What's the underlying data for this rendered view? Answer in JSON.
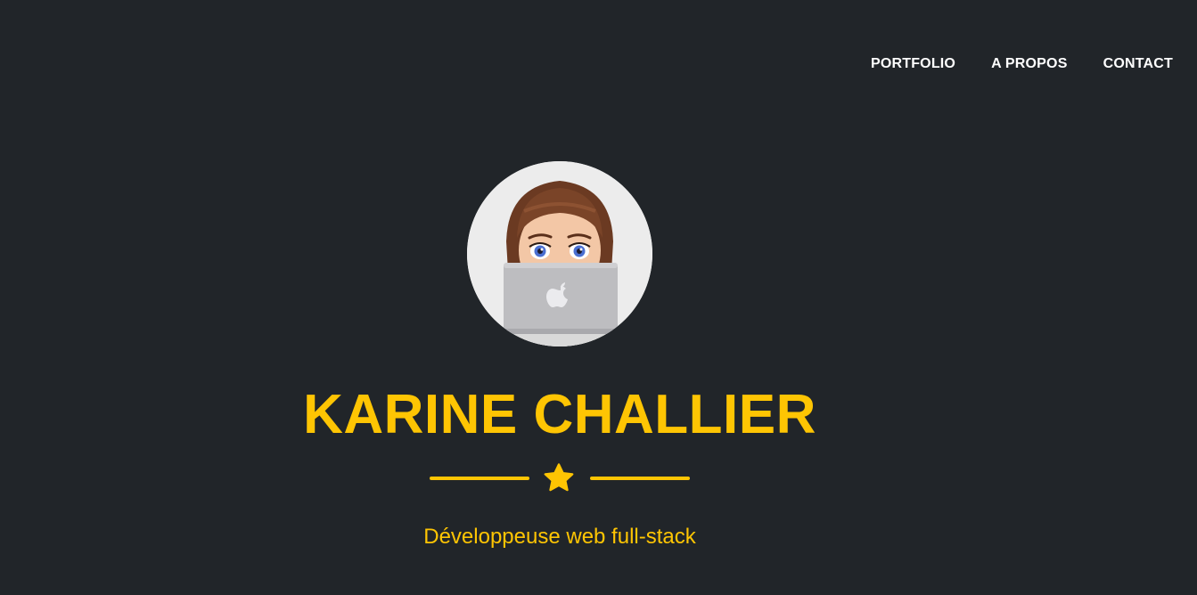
{
  "nav": {
    "items": [
      {
        "label": "PORTFOLIO"
      },
      {
        "label": "A PROPOS"
      },
      {
        "label": "CONTACT"
      }
    ]
  },
  "hero": {
    "name": "KARINE CHALLIER",
    "subtitle": "Développeuse web full-stack",
    "divider_icon": "star-icon",
    "avatar": "memoji-laptop-avatar"
  },
  "colors": {
    "background": "#212529",
    "accent": "#fec503",
    "nav_text": "#ffffff"
  }
}
